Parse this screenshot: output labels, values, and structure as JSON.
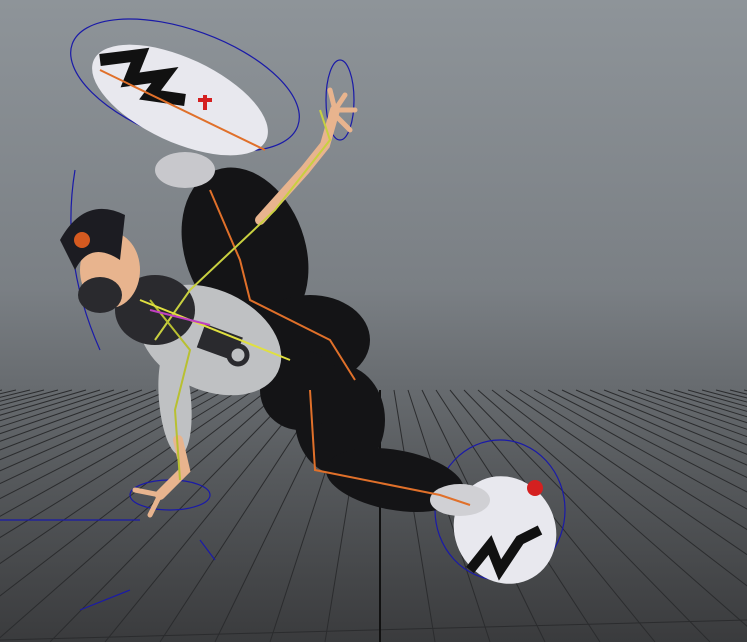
{
  "viewport": {
    "name": "perspective-viewport",
    "colors": {
      "grid": "#2b2c2e",
      "grid_axis": "#111111",
      "pants": "#141416",
      "hoodie": "#bfc1c3",
      "skin": "#e8b48e",
      "shoe": "#e8e8ee",
      "shoe_accent": "#d42020",
      "rig_bone": "#e0702a",
      "rig_control": "#1a1aa8",
      "cap": "#1c1c22"
    },
    "icons": [
      "character-model",
      "ik-control-curve",
      "skeleton-joint"
    ]
  }
}
